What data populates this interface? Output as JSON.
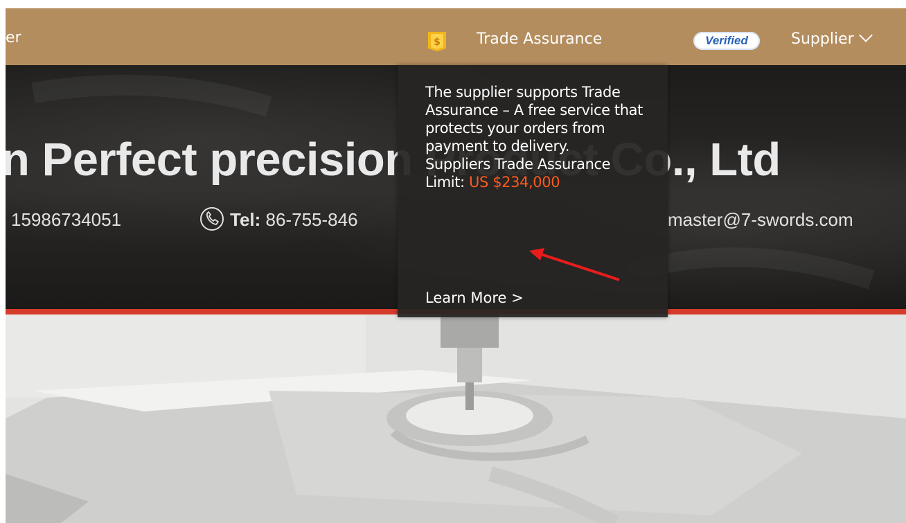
{
  "topbar": {
    "left_text": "er",
    "trade_assurance_label": "Trade Assurance",
    "verified_badge": "Verified",
    "supplier_menu": "Supplier",
    "bg_color": "#b48d5e"
  },
  "banner": {
    "company_name": "n Perfect precision Product Co., Ltd",
    "mobile": "15986734051",
    "tel_label": "Tel:",
    "tel_value": "86-755-846",
    "email": "master@7-swords.com",
    "accent_color": "#d53a2a"
  },
  "tooltip": {
    "line_text": "The supplier supports Trade Assurance – A free service that protects your orders from payment to delivery.",
    "limit_label": "Suppliers Trade Assurance Limit:",
    "limit_value": "US $234,000",
    "learn_more": "Learn More >",
    "limit_color": "#ff5a1f"
  },
  "icons": {
    "trade_assurance": "shield-icon",
    "phone": "phone-icon",
    "chevron": "chevron-down-icon",
    "annotation": "red-arrow-icon"
  }
}
